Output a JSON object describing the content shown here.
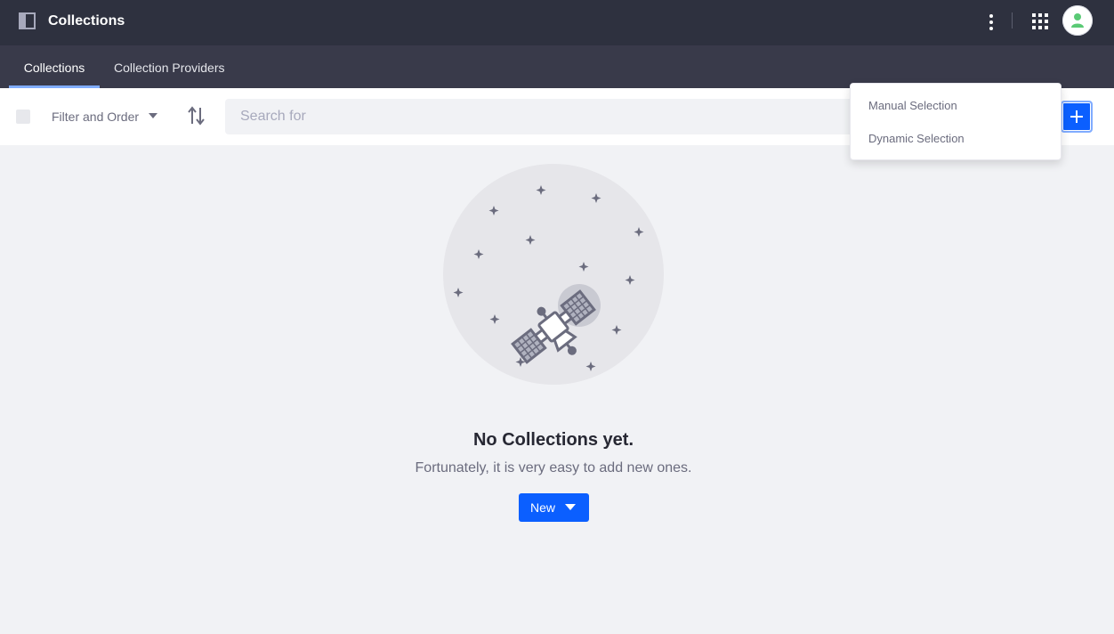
{
  "app": {
    "title": "Collections"
  },
  "header_icons": {
    "panel": "product-menu-panel-icon",
    "more": "ellipsis-v-icon",
    "apps": "apps-grid-icon",
    "avatar": "user-avatar-icon"
  },
  "tabs": [
    {
      "label": "Collections",
      "active": true
    },
    {
      "label": "Collection Providers",
      "active": false
    }
  ],
  "toolbar": {
    "filter_label": "Filter and Order",
    "search_placeholder": "Search for"
  },
  "add_menu": {
    "items": [
      {
        "label": "Manual Selection"
      },
      {
        "label": "Dynamic Selection"
      }
    ]
  },
  "empty_state": {
    "title": "No Collections yet.",
    "description": "Fortunately, it is very easy to add new ones.",
    "button_label": "New"
  },
  "colors": {
    "topbar": "#2e313f",
    "subnav": "#393a4a",
    "primary": "#0b5fff",
    "active_tab_underline": "#80acff",
    "background": "#f1f2f5",
    "avatar_accent": "#5aca75"
  }
}
